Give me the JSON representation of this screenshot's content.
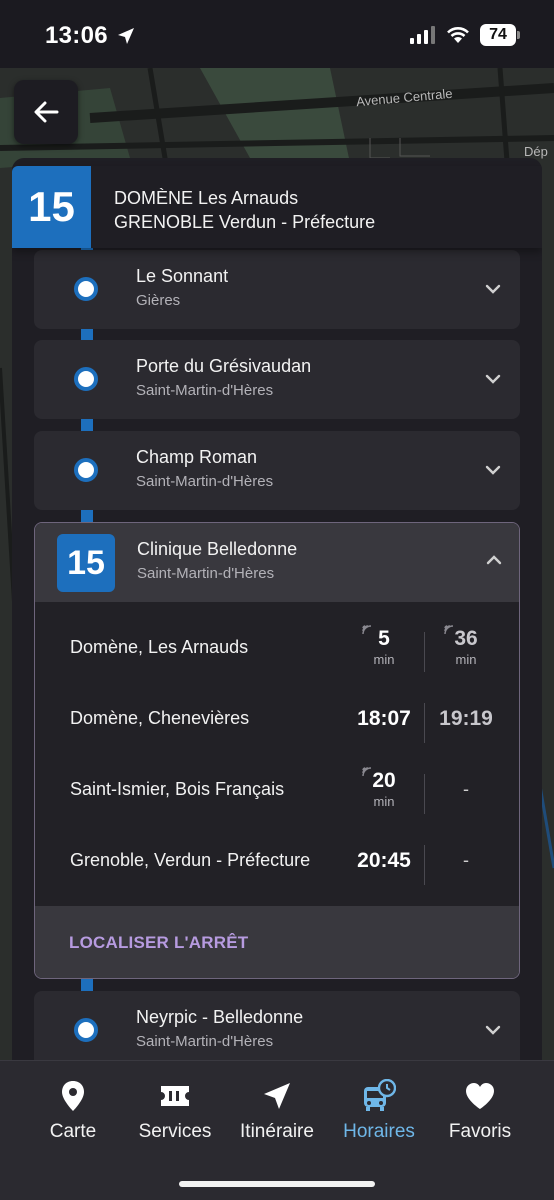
{
  "status_bar": {
    "time": "13:06",
    "battery": "74"
  },
  "map": {
    "road_label": "Avenue Centrale",
    "edge_label": "Dép"
  },
  "header": {
    "line_number": "15",
    "direction_1": "DOMÈNE Les Arnauds",
    "direction_2": "GRENOBLE Verdun - Préfecture",
    "line_color": "#1d6fbd"
  },
  "stops": [
    {
      "name": "Le Sonnant",
      "city": "Gières"
    },
    {
      "name": "Porte du Grésivaudan",
      "city": "Saint-Martin-d'Hères"
    },
    {
      "name": "Champ Roman",
      "city": "Saint-Martin-d'Hères"
    }
  ],
  "selected_stop": {
    "line_number": "15",
    "name": "Clinique Belledonne",
    "city": "Saint-Martin-d'Hères",
    "departures": [
      {
        "destination": "Domène, Les Arnauds",
        "first": "5",
        "first_unit": "min",
        "second": "36",
        "second_unit": "min"
      },
      {
        "destination": "Domène, Chenevières",
        "first": "18:07",
        "second": "19:19"
      },
      {
        "destination": "Saint-Ismier, Bois Français",
        "first": "20",
        "first_unit": "min",
        "second": "-"
      },
      {
        "destination": "Grenoble, Verdun - Préfecture",
        "first": "20:45",
        "second": "-"
      }
    ],
    "locate_label": "LOCALISER L'ARRÊT"
  },
  "next_stop": {
    "name": "Neyrpic - Belledonne",
    "city": "Saint-Martin-d'Hères"
  },
  "tabs": [
    {
      "label": "Carte",
      "icon": "map-pin-icon"
    },
    {
      "label": "Services",
      "icon": "ticket-icon"
    },
    {
      "label": "Itinéraire",
      "icon": "navigation-arrow-icon"
    },
    {
      "label": "Horaires",
      "icon": "bus-clock-icon",
      "active": true
    },
    {
      "label": "Favoris",
      "icon": "heart-icon"
    }
  ],
  "colors": {
    "accent": "#6fb7e8",
    "link": "#b79be0",
    "line": "#1d6fbd"
  }
}
